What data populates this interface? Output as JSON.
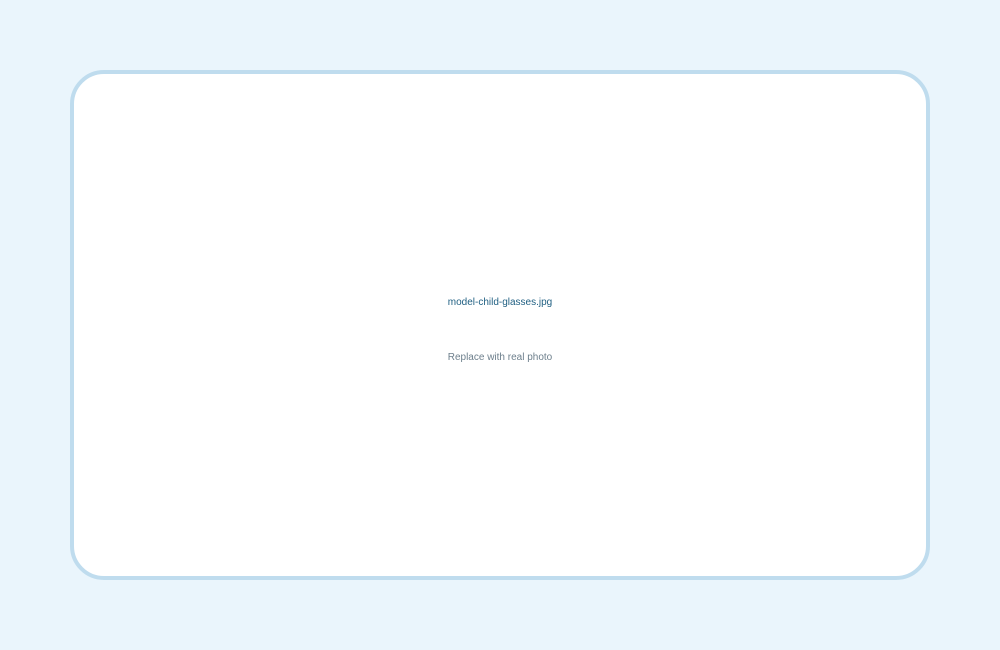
{
  "placeholder": {
    "filename": "model-child-glasses.jpg",
    "note": "Replace with real photo"
  },
  "colors": {
    "page_background": "#EAF5FC",
    "card_background": "#FFFFFF",
    "card_border": "#BFDCEE",
    "filename_text": "#1F5F82",
    "note_text": "#6D7F8C"
  }
}
